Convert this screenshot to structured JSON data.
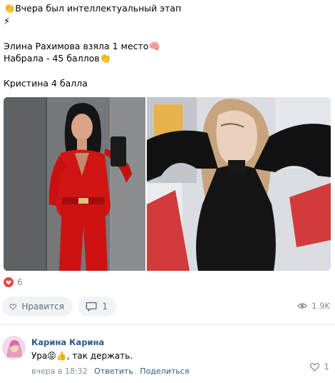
{
  "post": {
    "lines": [
      {
        "emoji": "👏",
        "text": "Вчера был интеллектуальный этап"
      },
      {
        "emoji": "⚡",
        "text": ""
      },
      {
        "emoji": "",
        "text": ""
      },
      {
        "emoji": "",
        "text": "Элина Рахимова взяла 1 место",
        "emoji_after": "🧠"
      },
      {
        "emoji": "",
        "text": "Набрала - 45 баллов",
        "emoji_after": "👏"
      },
      {
        "emoji": "",
        "text": ""
      },
      {
        "emoji": "",
        "text": "Кристина 4 балла"
      }
    ]
  },
  "reactions": {
    "count": "6",
    "icon": "heart-icon",
    "color": "#e64646"
  },
  "actions": {
    "like_label": "Нравится",
    "comment_count": "1",
    "views": "1.9K"
  },
  "comment": {
    "author": "Карина Карина",
    "text_start": "Ура",
    "emoji_1": "😝",
    "emoji_2": "👍",
    "text_end": ", так держать.",
    "time": "вчера в 18:32",
    "reply_label": "Ответить",
    "share_label": "Поделиться",
    "likes": "1"
  },
  "colors": {
    "link": "#2a5885",
    "muted": "#818c99",
    "button_bg": "#f0f2f5"
  }
}
